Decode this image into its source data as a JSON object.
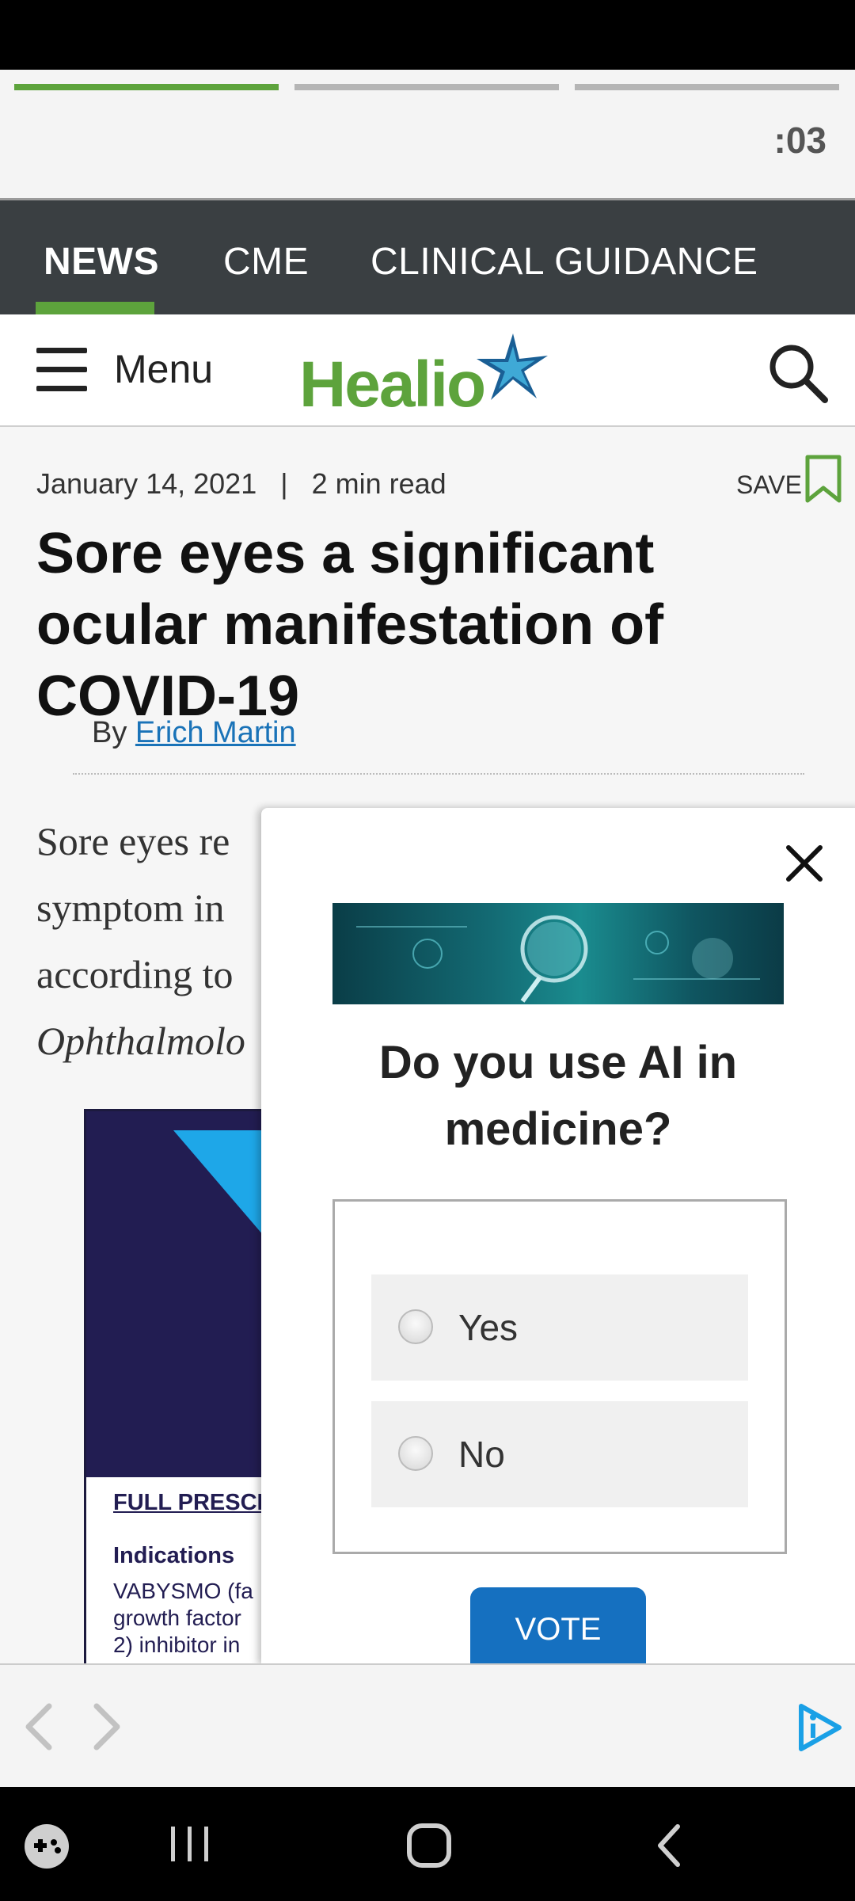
{
  "story": {
    "segments": [
      true,
      false,
      false
    ],
    "timer": ":03"
  },
  "nav": {
    "tabs": [
      {
        "label": "NEWS",
        "active": true
      },
      {
        "label": "CME",
        "active": false
      },
      {
        "label": "CLINICAL GUIDANCE",
        "active": false
      }
    ]
  },
  "header": {
    "menu_label": "Menu",
    "logo_text": "Healio",
    "brand_color": "#5da33c"
  },
  "article": {
    "date": "January 14, 2021",
    "read_time": "2 min read",
    "save_label": "SAVE",
    "headline": "Sore eyes a significant ocular manifestation of COVID-19",
    "byline_prefix": "By",
    "author": "Erich Martin",
    "body_lines": [
      "Sore eyes re",
      "symptom in",
      "according to"
    ],
    "body_italic": "Ophthalmolo"
  },
  "ad": {
    "link_text": "FULL PRESCR",
    "indications_heading": "Indications",
    "lines": [
      "VABYSMO (fa",
      "growth factor",
      "2) inhibitor in"
    ]
  },
  "poll": {
    "question": "Do you use AI in medicine?",
    "options": [
      "Yes",
      "No"
    ],
    "vote_label": "VOTE"
  }
}
